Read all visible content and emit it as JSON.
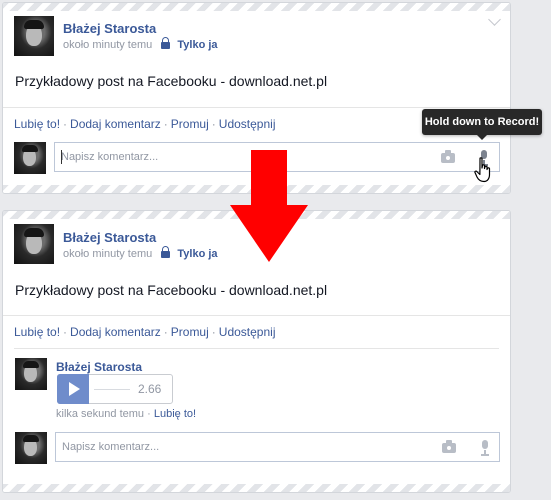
{
  "post": {
    "author": "Błażej Starosta",
    "time": "około minuty temu",
    "audience": "Tylko ja",
    "text": "Przykładowy post na Facebooku - download.net.pl"
  },
  "actions": {
    "like": "Lubię to!",
    "comment": "Dodaj komentarz",
    "promote": "Promuj",
    "share": "Udostępnij",
    "separator": "·"
  },
  "composer": {
    "placeholder": "Napisz komentarz..."
  },
  "tooltip": {
    "text": "Hold down to Record!"
  },
  "audio_comment": {
    "author": "Błażej Starosta",
    "duration": "2.66",
    "time": "kilka sekund temu",
    "like": "Lubię to!"
  },
  "icons": {
    "lock": "lock-icon",
    "chevron": "chevron-down-icon",
    "camera": "camera-icon",
    "microphone": "microphone-icon",
    "cursor": "hand-cursor-icon",
    "arrow": "red-arrow-down-icon",
    "play": "play-icon"
  },
  "colors": {
    "link": "#3b5998",
    "muted": "#9197a3",
    "arrow": "#ff0000",
    "play_button": "#6f8ccb"
  }
}
